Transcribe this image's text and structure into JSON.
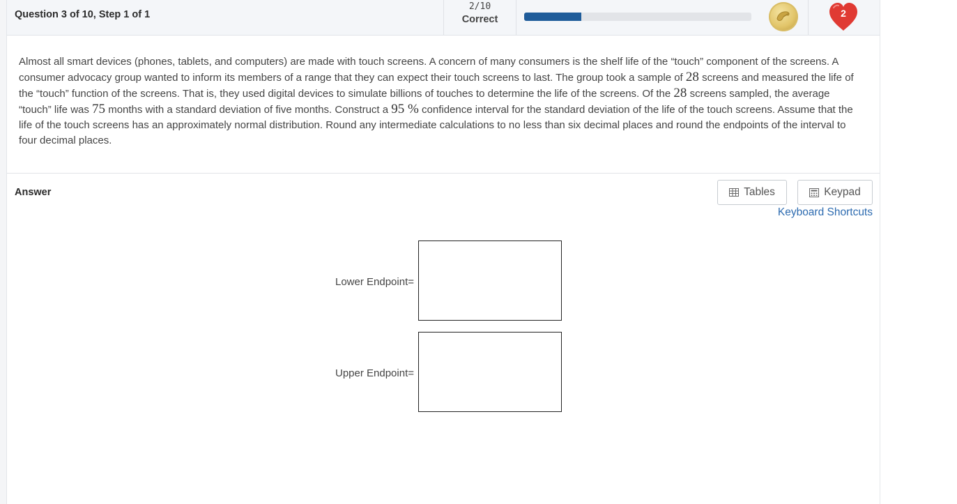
{
  "header": {
    "question_title": "Question 3 of 10, Step 1 of 1",
    "score_fraction": "2/10",
    "score_label": "Correct",
    "progress_fraction": 0.25,
    "coin_icon": "coin-icon",
    "lives_count": "2",
    "colors": {
      "progress_fill": "#1f5c9a",
      "heart": "#e03a33"
    }
  },
  "question": {
    "p1": "Almost all smart devices (phones, tablets, and computers) are made with touch screens. A concern of many consumers is the shelf life of the “touch” component of the screens. A consumer advocacy group wanted to inform its members of a range that they can expect their touch screens to last. The group took a sample of ",
    "n_value": "28",
    "p2": " screens and measured the life of the “touch” function of the screens. That is, they used digital devices to simulate billions of touches to determine the life of the screens. Of the ",
    "n_value_2": "28",
    "p3": " screens sampled, the average “touch” life was ",
    "mean_value": "75",
    "p4": " months with a standard deviation of five months. Construct a ",
    "conf_value": "95 %",
    "p5": "  confidence interval for the standard deviation of the life of the touch screens. Assume that the life of the touch screens has an approximately normal distribution. Round any intermediate calculations to no less than six decimal places and round the endpoints of the interval to four decimal places."
  },
  "answer": {
    "label": "Answer",
    "tables_button": "Tables",
    "keypad_button": "Keypad",
    "keyboard_shortcuts_link": "Keyboard Shortcuts",
    "lower_label": "Lower Endpoint=",
    "lower_value": "",
    "upper_label": "Upper Endpoint=",
    "upper_value": ""
  }
}
